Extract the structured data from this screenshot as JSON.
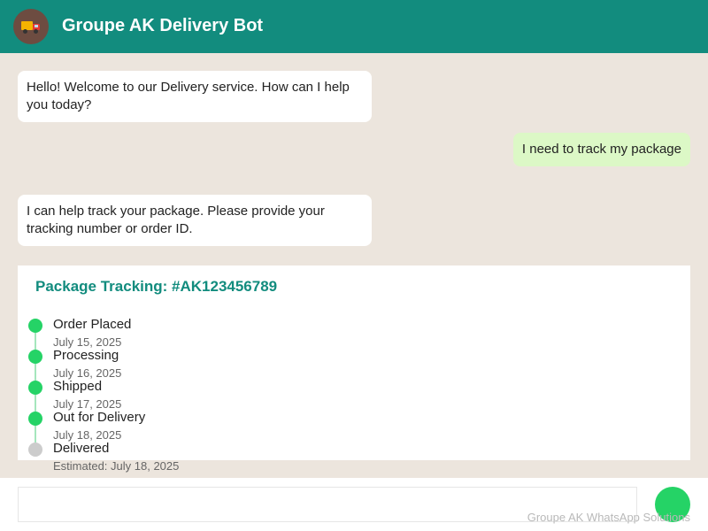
{
  "header": {
    "title": "Groupe AK Delivery Bot",
    "avatar_icon": "delivery-truck-icon"
  },
  "messages": [
    {
      "sender": "bot",
      "text": "Hello! Welcome to our Delivery service. How can I help you today?"
    },
    {
      "sender": "user",
      "text": "I need to track my package"
    },
    {
      "sender": "bot",
      "text": "I can help track your package. Please provide your tracking number or order ID."
    }
  ],
  "tracking": {
    "title": "Package Tracking: #AK123456789",
    "steps": [
      {
        "status": "Order Placed",
        "date": "July 15, 2025",
        "complete": true
      },
      {
        "status": "Processing",
        "date": "July 16, 2025",
        "complete": true
      },
      {
        "status": "Shipped",
        "date": "July 17, 2025",
        "complete": true
      },
      {
        "status": "Out for Delivery",
        "date": "July 18, 2025",
        "complete": true
      },
      {
        "status": "Delivered",
        "date": "Estimated: July 18, 2025",
        "complete": false
      }
    ]
  },
  "input": {
    "value": "",
    "placeholder": ""
  },
  "footer": {
    "text": "Groupe AK WhatsApp Solutions"
  },
  "colors": {
    "header": "#128c7e",
    "background": "#ece5dd",
    "user_bubble": "#dcf8c6",
    "accent": "#25d366",
    "pending": "#cccccc"
  }
}
